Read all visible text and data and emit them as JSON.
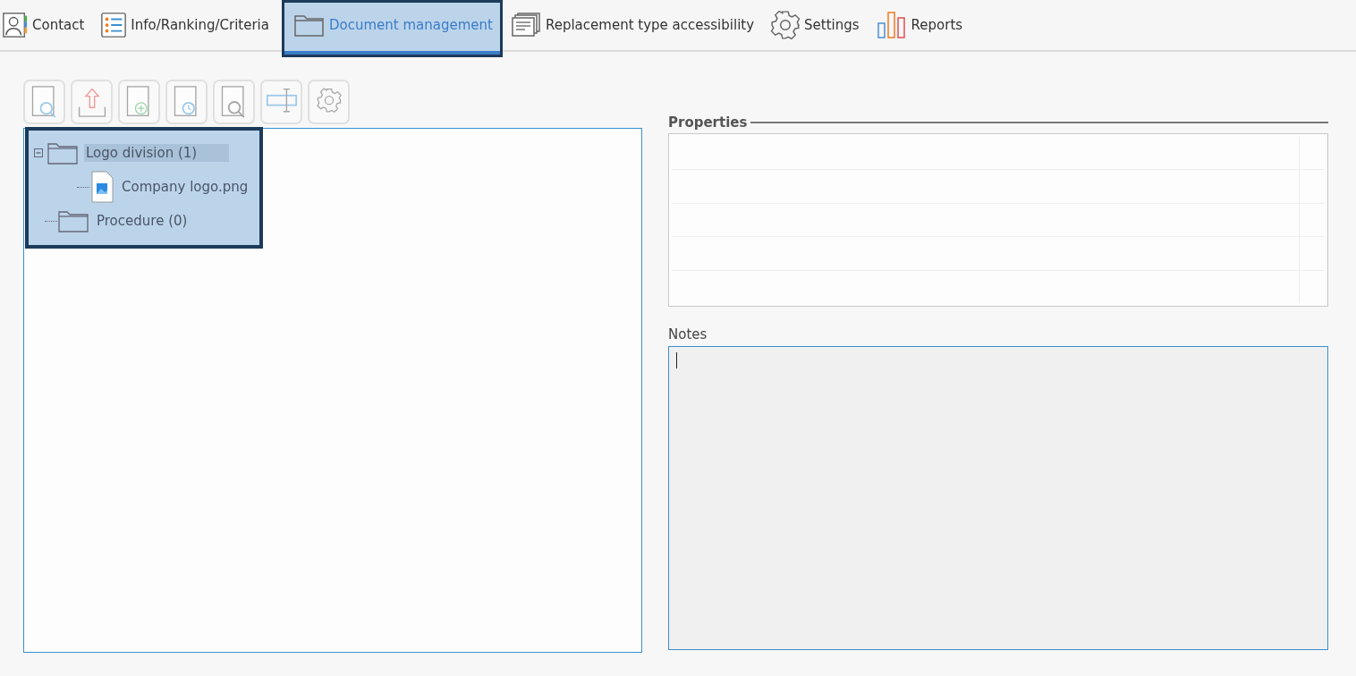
{
  "tabs": [
    {
      "label": "Contact",
      "kind": "contact",
      "selected": false
    },
    {
      "label": "Info/Ranking/Criteria",
      "kind": "list",
      "selected": false
    },
    {
      "label": "Document management",
      "kind": "folder",
      "selected": true
    },
    {
      "label": "Replacement type accessibility",
      "kind": "pages",
      "selected": false
    },
    {
      "label": "Settings",
      "kind": "gear",
      "selected": false
    },
    {
      "label": "Reports",
      "kind": "chart",
      "selected": false
    }
  ],
  "toolbar": [
    {
      "kind": "view",
      "disabled": true
    },
    {
      "kind": "upload",
      "disabled": true
    },
    {
      "kind": "add",
      "disabled": true
    },
    {
      "kind": "history",
      "disabled": true
    },
    {
      "kind": "preview",
      "disabled": true
    },
    {
      "kind": "rename",
      "disabled": true
    },
    {
      "kind": "settings",
      "disabled": true
    }
  ],
  "tree": [
    {
      "label": "Logo division (1)",
      "kind": "folder",
      "expanded": true,
      "selected": true,
      "children": [
        {
          "label": "Company logo.png",
          "kind": "image",
          "selected": false
        }
      ]
    },
    {
      "label": "Procedure (0)",
      "kind": "folder",
      "selected": false
    }
  ],
  "properties": {
    "title": "Properties"
  },
  "notes": {
    "label": "Notes",
    "focused": true
  }
}
